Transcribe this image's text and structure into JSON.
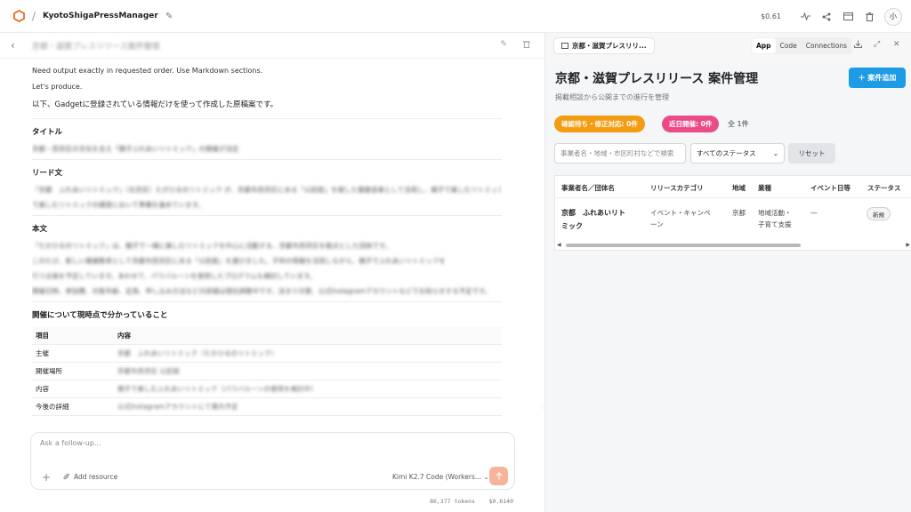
{
  "topbar": {
    "project_name": "KyotoShigaPressManager",
    "cost": "$0.61",
    "avatar": "小",
    "icons": [
      "activity-icon",
      "share-icon",
      "window-icon",
      "trash-icon"
    ]
  },
  "chat": {
    "title": "京都・滋賀プレスリリース案件管理",
    "lines": [
      "Need output exactly in requested order. Use Markdown sections.",
      "Let's produce."
    ],
    "intro": "以下、Gadgetに登録されている情報だけを使って作成した原稿案です。",
    "sections": {
      "title_heading": "タイトル",
      "title_text": "京都・西京区の文化を支え「親子ふれあいリトミック」の開催が決定",
      "lead_heading": "リード文",
      "lead_text": [
        "「京都　ふれあいリトミック」（北京区）たがひるのリトミック が、京都市西京区にある「公民館」を使した健康音楽として活用し、親子で楽しむリトミックの講習において準備を進めています。",
        "で楽しむリトミックの講習において準備を進めています。"
      ],
      "body_heading": "本文",
      "body_text": [
        "「たかひるのリトミック」は、親子で一緒に楽しむリトミックを中心に活動する、京都市西京区を拠点とした団体です。",
        "このたび、新しい健康教育として京都市西京区にある「公民館」を選びました。子供の情報を活用しながら、親子でふれあいリトミックを",
        "行う企画を予定しています。あわせて、パラバルーンを使用したプログラムも検討しています。",
        "開催日時、参加費、対象年齢、定員、申し込み方法などの詳細は現在調整中です。決まり次第、公式Instagramアカウントなどでお知らせする予定です。"
      ],
      "table_heading": "開催について現時点で分かっていること",
      "table": {
        "headers": [
          "項目",
          "内容"
        ],
        "rows": [
          [
            "主催",
            "京都　ふれあいリトミック（たかひるのリトミック）"
          ],
          [
            "開催場所",
            "京都市西京区 公民館"
          ],
          [
            "内容",
            "親子で楽しむふれあいリトミック（パラバルーンの使用を検討中）"
          ],
          [
            "今後の詳細",
            "公式Instagramアカウントにて案内予定"
          ]
        ]
      }
    },
    "composer": {
      "placeholder": "Ask a follow-up...",
      "add_resource": "Add resource",
      "model": "Kimi K2.7 Code (Workers...",
      "tokens": "86,377 tokens",
      "cost": "$0.6140"
    }
  },
  "preview": {
    "tab_label": "京都・滋賀プレスリリ...",
    "segments": [
      "App",
      "Code",
      "Connections"
    ],
    "active_segment": "App",
    "app": {
      "title": "京都・滋賀プレスリリース 案件管理",
      "subtitle": "掲載相談から公開までの進行を管理",
      "add_button": "案件追加",
      "badge_pending": "確認待ち・修正対応: 0件",
      "badge_upcoming": "近日開催: 0件",
      "total": "全 1件",
      "search_placeholder": "事業者名・地域・市区町村などで検索",
      "status_select": "すべてのステータス",
      "reset": "リセット",
      "columns": [
        "事業者名／団体名",
        "リリースカテゴリ",
        "地域",
        "業種",
        "イベント日等",
        "ステータス"
      ],
      "rows": [
        {
          "name_line1": "京都　ふれあいリト",
          "name_line2": "ミック",
          "category_line1": "イベント・キャンペ",
          "category_line2": "ーン",
          "region": "京都",
          "industry_line1": "地域活動・",
          "industry_line2": "子育て支援",
          "event_date": "―",
          "status": "新規"
        }
      ]
    },
    "colors": {
      "accent": "#1e9be5",
      "badge_orange": "#f39c12",
      "badge_pink": "#ea4c89",
      "send": "#f7b49b"
    }
  }
}
